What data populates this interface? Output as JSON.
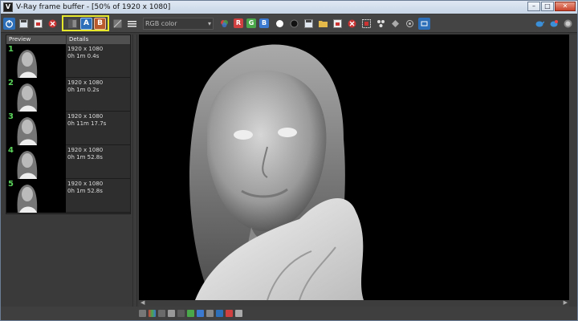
{
  "window": {
    "title": "V-Ray frame buffer - [50% of 1920 x 1080]",
    "app_icon": "V",
    "buttons": {
      "minimize": "–",
      "maximize": "□",
      "close": "✕"
    }
  },
  "toolbar": {
    "left_icons": [
      "power-icon",
      "save-icon",
      "save-all-icon",
      "clear-icon",
      "history-icon",
      "compare-a-icon",
      "compare-b-icon",
      "lens-icon",
      "menu-icon"
    ],
    "compare_a_label": "A",
    "compare_b_label": "B",
    "channel_select": {
      "value": "RGB color"
    },
    "rgb_buttons": [
      "R",
      "G",
      "B"
    ],
    "colors": {
      "r": "#d04040",
      "g": "#4aa84a",
      "b": "#3b78d0",
      "highlight": "#e6e62a"
    }
  },
  "history": {
    "headers": {
      "preview": "Preview",
      "details": "Details"
    },
    "items": [
      {
        "number": "1",
        "resolution": "1920 x 1080",
        "time": "0h 1m 0.4s"
      },
      {
        "number": "2",
        "resolution": "1920 x 1080",
        "time": "0h 1m 0.2s"
      },
      {
        "number": "3",
        "resolution": "1920 x 1080",
        "time": "0h 11m 17.7s"
      },
      {
        "number": "4",
        "resolution": "1920 x 1080",
        "time": "0h 1m 52.8s"
      },
      {
        "number": "5",
        "resolution": "1920 x 1080",
        "time": "0h 1m 52.8s"
      }
    ]
  },
  "viewport": {
    "subject": "grayscale-render-woman-portrait"
  }
}
